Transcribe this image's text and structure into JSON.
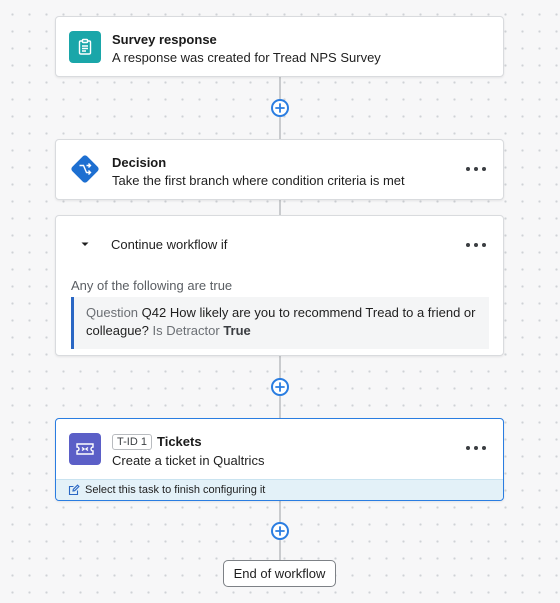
{
  "trigger": {
    "title": "Survey response",
    "subtitle": "A response was created for Tread NPS Survey",
    "icon": "clipboard-icon",
    "icon_color": "#1aa6a9"
  },
  "decision": {
    "title": "Decision",
    "subtitle": "Take the first branch where condition criteria is met",
    "icon": "branch-icon",
    "icon_color": "#1d6fd1"
  },
  "branch": {
    "title": "Continue workflow if",
    "match_text": "Any of the following are true",
    "condition": {
      "prefix": "Question",
      "question": "Q42 How likely are you to recommend Tread to a friend or",
      "question_cont": "colleague?",
      "operator": "Is Detractor",
      "value": "True"
    }
  },
  "task": {
    "badge": "T-ID 1",
    "title": "Tickets",
    "subtitle": "Create a ticket in Qualtrics",
    "hint": "Select this task to finish configuring it",
    "icon": "ticket-icon",
    "icon_color": "#5b5fc7"
  },
  "end": {
    "label": "End of workflow"
  },
  "colors": {
    "accent": "#2a7de1",
    "condition_bar": "#2a67c4",
    "hint_bg": "#e3f1f8"
  }
}
